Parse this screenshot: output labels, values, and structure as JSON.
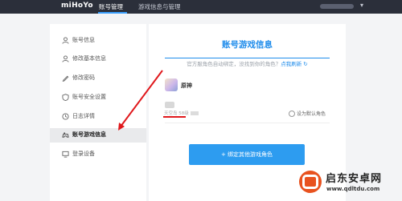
{
  "header": {
    "logo": "miHoYo",
    "tabs": [
      {
        "label": "账号管理",
        "active": true
      },
      {
        "label": "游戏信息与管理",
        "active": false
      }
    ]
  },
  "sidebar": {
    "items": [
      {
        "label": "账号信息",
        "icon": "user-icon"
      },
      {
        "label": "修改基本信息",
        "icon": "user-edit-icon"
      },
      {
        "label": "修改密码",
        "icon": "pencil-icon"
      },
      {
        "label": "账号安全设置",
        "icon": "shield-icon"
      },
      {
        "label": "日志详情",
        "icon": "clock-icon"
      },
      {
        "label": "账号游戏信息",
        "icon": "gamepad-icon",
        "active": true
      },
      {
        "label": "登录设备",
        "icon": "device-icon"
      }
    ]
  },
  "main": {
    "title": "账号游戏信息",
    "hint_prefix": "官方服角色自动绑定，没找到你的角色？",
    "hint_link": "点我刷新 ↻",
    "game": {
      "name": "原神",
      "role_info": "天空岛 58级",
      "default_label": "设为默认角色"
    },
    "bind_button": "+ 绑定其他游戏角色"
  },
  "watermark": {
    "title": "启东安卓网",
    "url": "www.qdltdu.com"
  },
  "colors": {
    "accent": "#1f8ceb",
    "button": "#2d9cf0",
    "annotation": "#e0181c",
    "topbar": "#2b2f3a"
  }
}
